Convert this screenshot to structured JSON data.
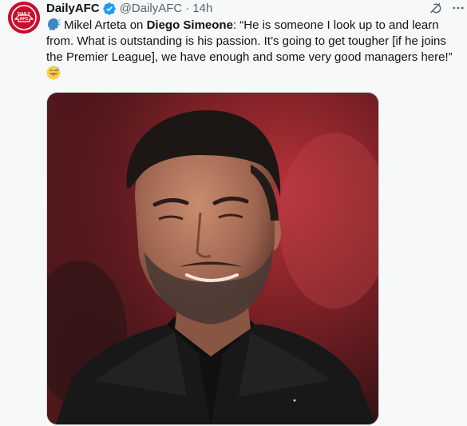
{
  "tweet": {
    "display_name": "DailyAFC",
    "handle": "@DailyAFC",
    "separator": "·",
    "time": "14h",
    "text": {
      "part1": " Mikel Arteta on ",
      "bold": "Diego Simeone",
      "part2": ": “He is someone I look up to and learn from. What is outstanding is his passion. It’s going to get tougher [if he joins the Premier League], we have enough and some very good managers here!”"
    },
    "avatar_text": "DAILY AFC",
    "leading_emoji": "speaking-head-emoji",
    "trailing_emoji": "sweat-smile-emoji",
    "media_description": "photo"
  },
  "colors": {
    "accent": "#1d9bf0",
    "brand_red": "#c8102e",
    "text_primary": "#0f1419",
    "text_secondary": "#536471",
    "background": "#f7f9f9"
  },
  "icons": [
    "verified-badge-icon",
    "grok-icon",
    "more-icon"
  ]
}
